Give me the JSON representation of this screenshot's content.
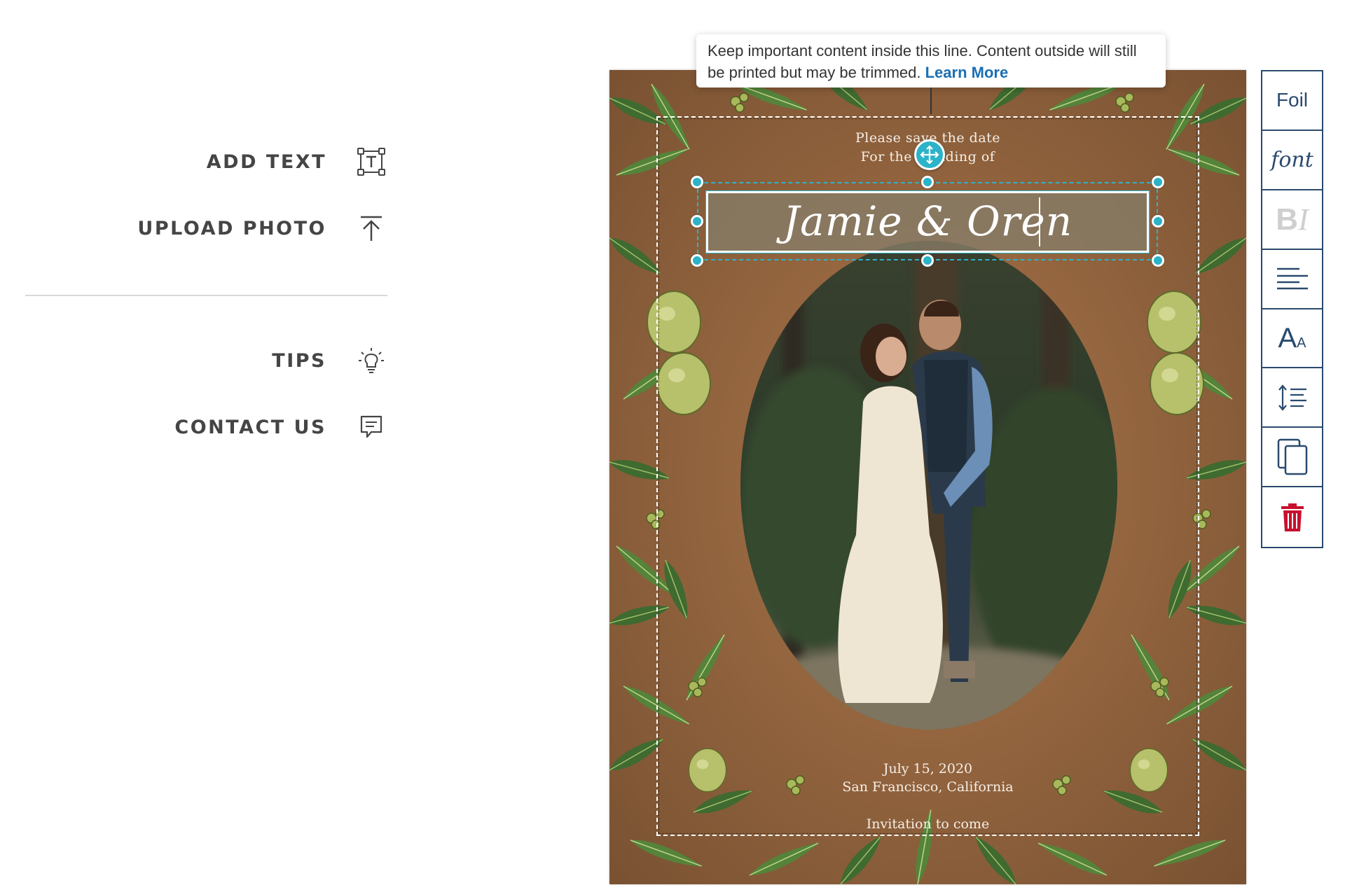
{
  "side_menu": {
    "add_text": {
      "label": "ADD TEXT",
      "icon": "text-box-icon"
    },
    "upload_photo": {
      "label": "UPLOAD PHOTO",
      "icon": "upload-arrow-icon"
    },
    "tips": {
      "label": "TIPS",
      "icon": "lightbulb-icon"
    },
    "contact_us": {
      "label": "CONTACT US",
      "icon": "chat-bubble-icon"
    }
  },
  "tooltip": {
    "text": "Keep important content inside this line. Content outside will still be printed but may be trimmed.",
    "link": "Learn More"
  },
  "card": {
    "line1": "Please save the date",
    "line2": "For the wedding of",
    "names": "Jamie & Oren",
    "date": "July 15, 2020",
    "location": "San Francisco, California",
    "footer": "Invitation to come",
    "colors": {
      "background": "#9a6a43",
      "leaf": "#3f6a30",
      "olive": "#b7c06a",
      "text": "#f6efe6"
    }
  },
  "toolbar": {
    "foil": "Foil",
    "font": "font",
    "bold": "B",
    "italic": "I",
    "align_icon": "align-left-icon",
    "size_big": "A",
    "size_small": "A",
    "line_spacing_icon": "line-spacing-icon",
    "duplicate_icon": "duplicate-icon",
    "delete_icon": "trash-icon",
    "colors": {
      "border": "#2a4a6e",
      "delete": "#c8102e",
      "disabled": "#cfcfcf"
    }
  },
  "selection": {
    "accent": "#2bb3c8"
  }
}
